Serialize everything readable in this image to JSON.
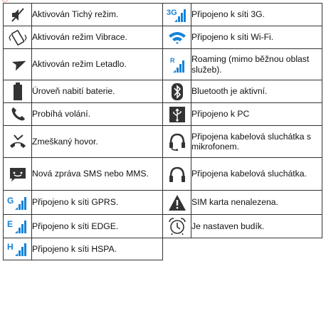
{
  "watermark": "C",
  "colors": {
    "accent": "#1583d8",
    "icon_dark": "#333333"
  },
  "rows": [
    {
      "left": {
        "icon": "silent-mode-icon",
        "text": "Aktivován Tichý režim."
      },
      "right": {
        "icon": "network-3g-icon",
        "text": "Připojeno k síti 3G."
      }
    },
    {
      "left": {
        "icon": "vibrate-mode-icon",
        "text": "Aktivován režim Vibrace."
      },
      "right": {
        "icon": "wifi-icon",
        "text": "Připojeno k síti Wi-Fi."
      }
    },
    {
      "left": {
        "icon": "airplane-mode-icon",
        "text": "Aktivován režim Letadlo."
      },
      "right": {
        "icon": "roaming-icon",
        "text": "Roaming (mimo běžnou oblast služeb)."
      }
    },
    {
      "left": {
        "icon": "battery-icon",
        "text": "Úroveň nabití baterie."
      },
      "right": {
        "icon": "bluetooth-icon",
        "text": "Bluetooth je aktivní."
      }
    },
    {
      "left": {
        "icon": "phone-call-icon",
        "text": "Probíhá volání."
      },
      "right": {
        "icon": "usb-icon",
        "text": "Připojeno k PC"
      }
    },
    {
      "left": {
        "icon": "missed-call-icon",
        "text": "Zmeškaný hovor."
      },
      "right": {
        "icon": "headset-mic-icon",
        "text": "Připojena kabelová sluchátka s mikrofonem."
      }
    },
    {
      "left": {
        "icon": "sms-icon",
        "text": "Nová zpráva SMS nebo MMS."
      },
      "right": {
        "icon": "headphones-icon",
        "text": "Připojena kabelová sluchátka."
      }
    },
    {
      "left": {
        "icon": "network-gprs-icon",
        "text": "Připojeno k síti GPRS."
      },
      "right": {
        "icon": "no-sim-icon",
        "text": "SIM karta nenalezena."
      }
    },
    {
      "left": {
        "icon": "network-edge-icon",
        "text": "Připojeno k síti EDGE."
      },
      "right": {
        "icon": "alarm-icon",
        "text": "Je nastaven budík."
      }
    },
    {
      "left": {
        "icon": "network-hspa-icon",
        "text": "Připojeno k síti HSPA."
      },
      "right": null
    }
  ]
}
